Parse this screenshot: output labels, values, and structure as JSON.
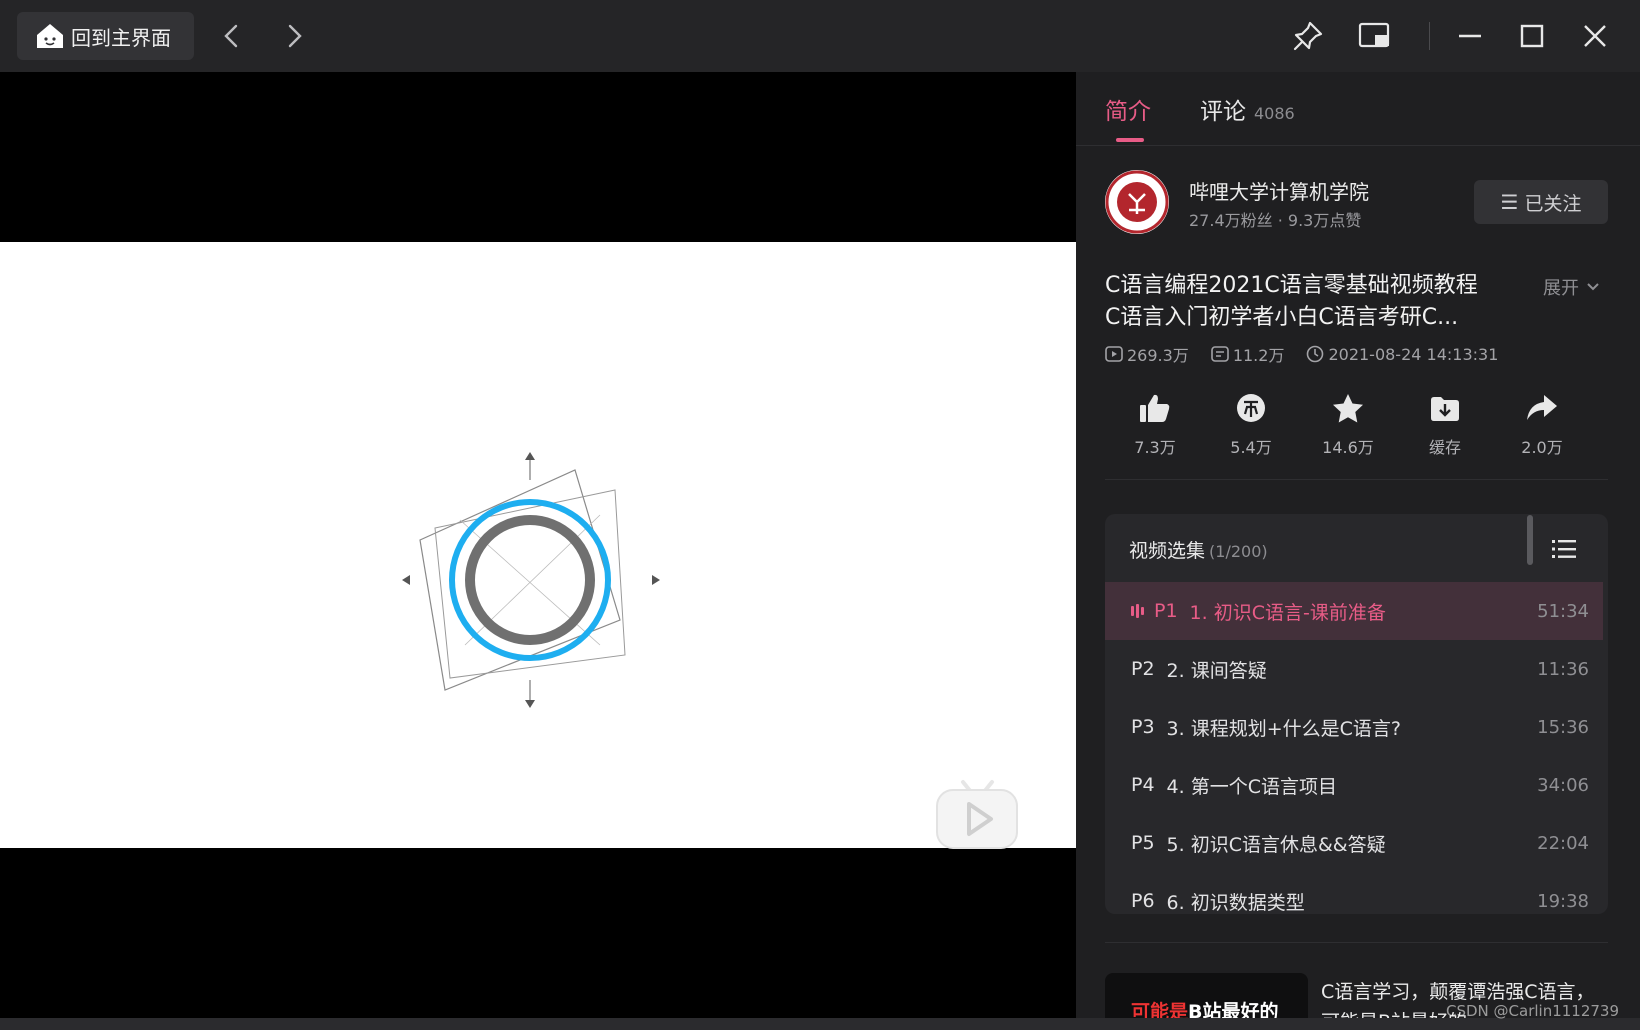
{
  "titlebar": {
    "home_label": "回到主界面",
    "icons": [
      "home-icon",
      "back-arrow-icon",
      "forward-arrow-icon",
      "pin-icon",
      "mini-window-icon",
      "minimize-icon",
      "maximize-icon",
      "close-icon"
    ]
  },
  "tabs": {
    "intro_label": "简介",
    "comments_label": "评论",
    "comments_count": "4086",
    "active_color": "#e85c87"
  },
  "uploader": {
    "name": "哔哩大学计算机学院",
    "stats": "27.4万粉丝 · 9.3万点赞",
    "follow_label": "已关注"
  },
  "video_info": {
    "title_line1": "C语言编程2021C语言零基础视频教程",
    "title_line2": "C语言入门初学者小白C语言考研C...",
    "expand_label": "展开",
    "views": "269.3万",
    "danmaku": "11.2万",
    "date": "2021-08-24 14:13:31"
  },
  "actions": {
    "like": "7.3万",
    "coin": "5.4万",
    "favorite": "14.6万",
    "cache": "缓存",
    "share": "2.0万"
  },
  "playlist": {
    "title": "视频选集",
    "count": "(1/200)",
    "episodes": [
      {
        "p": "P1",
        "title": "1. 初识C语言-课前准备",
        "duration": "51:34",
        "active": true
      },
      {
        "p": "P2",
        "title": "2. 课间答疑",
        "duration": "11:36"
      },
      {
        "p": "P3",
        "title": "3. 课程规划+什么是C语言?",
        "duration": "15:36"
      },
      {
        "p": "P4",
        "title": "4. 第一个C语言项目",
        "duration": "34:06"
      },
      {
        "p": "P5",
        "title": "5. 初识C语言休息&&答疑",
        "duration": "22:04"
      },
      {
        "p": "P6",
        "title": "6. 初识数据类型",
        "duration": "19:38"
      }
    ]
  },
  "recommend": {
    "thumb_red": "可能是",
    "thumb_white": "B站最好的",
    "title": "C语言学习，颠覆谭浩强C语言，可能是B站最好的"
  },
  "watermark": "CSDN @Carlin1112739"
}
